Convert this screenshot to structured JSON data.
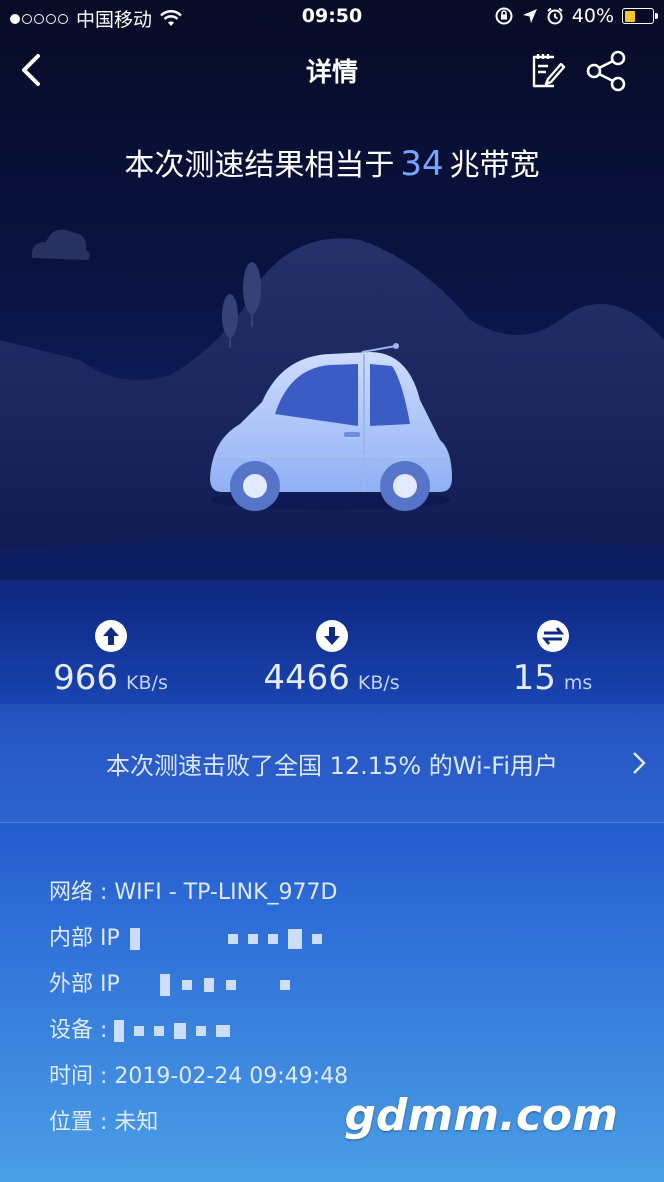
{
  "status_bar": {
    "carrier": "中国移动",
    "time": "09:50",
    "battery": "40%",
    "battery_level": 0.4,
    "signal_dots_filled": 1,
    "signal_dots_total": 5
  },
  "nav": {
    "title": "详情"
  },
  "headline": {
    "prefix": "本次测速结果相当于",
    "value": "34",
    "suffix": "兆带宽"
  },
  "stats": {
    "upload": {
      "value": "966",
      "unit": "KB/s",
      "icon": "upload-arrow-icon"
    },
    "download": {
      "value": "4466",
      "unit": "KB/s",
      "icon": "download-arrow-icon"
    },
    "ping": {
      "value": "15",
      "unit": "ms",
      "icon": "swap-arrows-icon"
    }
  },
  "rank": {
    "text": "本次测速击败了全国 12.15% 的Wi-Fi用户"
  },
  "info": {
    "network_label": "网络 : ",
    "network_value": "WIFI - TP-LINK_977D",
    "internal_ip_label": "内部 IP",
    "external_ip_label": "外部 IP",
    "device_label": "设备 : ",
    "time_label": "时间 : ",
    "time_value": "2019-02-24 09:49:48",
    "location_label": "位置 : ",
    "location_value": "未知"
  },
  "watermark": "gdmm.com",
  "colors": {
    "accent_number": "#7aa5ff",
    "battery": "#f7c62f"
  }
}
